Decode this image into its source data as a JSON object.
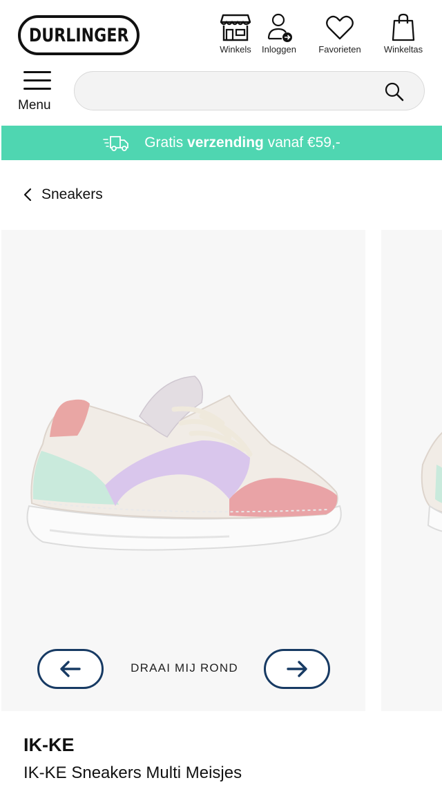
{
  "header": {
    "logo": "DURLINGER",
    "nav": [
      {
        "label": "Winkels",
        "icon": "store-icon"
      },
      {
        "label": "Inloggen",
        "icon": "user-login-icon"
      },
      {
        "label": "Favorieten",
        "icon": "heart-icon"
      },
      {
        "label": "Winkeltas",
        "icon": "shopping-bag-icon"
      }
    ],
    "menu_label": "Menu",
    "search_placeholder": ""
  },
  "promo": {
    "text_prefix": "Gratis ",
    "text_bold": "verzending",
    "text_suffix": " vanaf €59,-",
    "icon": "delivery-truck-icon",
    "color": "#4fd6b1"
  },
  "breadcrumb": {
    "label": "Sneakers",
    "icon": "chevron-left-icon"
  },
  "gallery": {
    "rotate_label": "DRAAI MIJ ROND",
    "prev_icon": "arrow-left-icon",
    "next_icon": "arrow-right-icon",
    "button_color": "#173a63"
  },
  "product": {
    "brand": "IK-KE",
    "name": "IK-KE Sneakers Multi Meisjes"
  }
}
